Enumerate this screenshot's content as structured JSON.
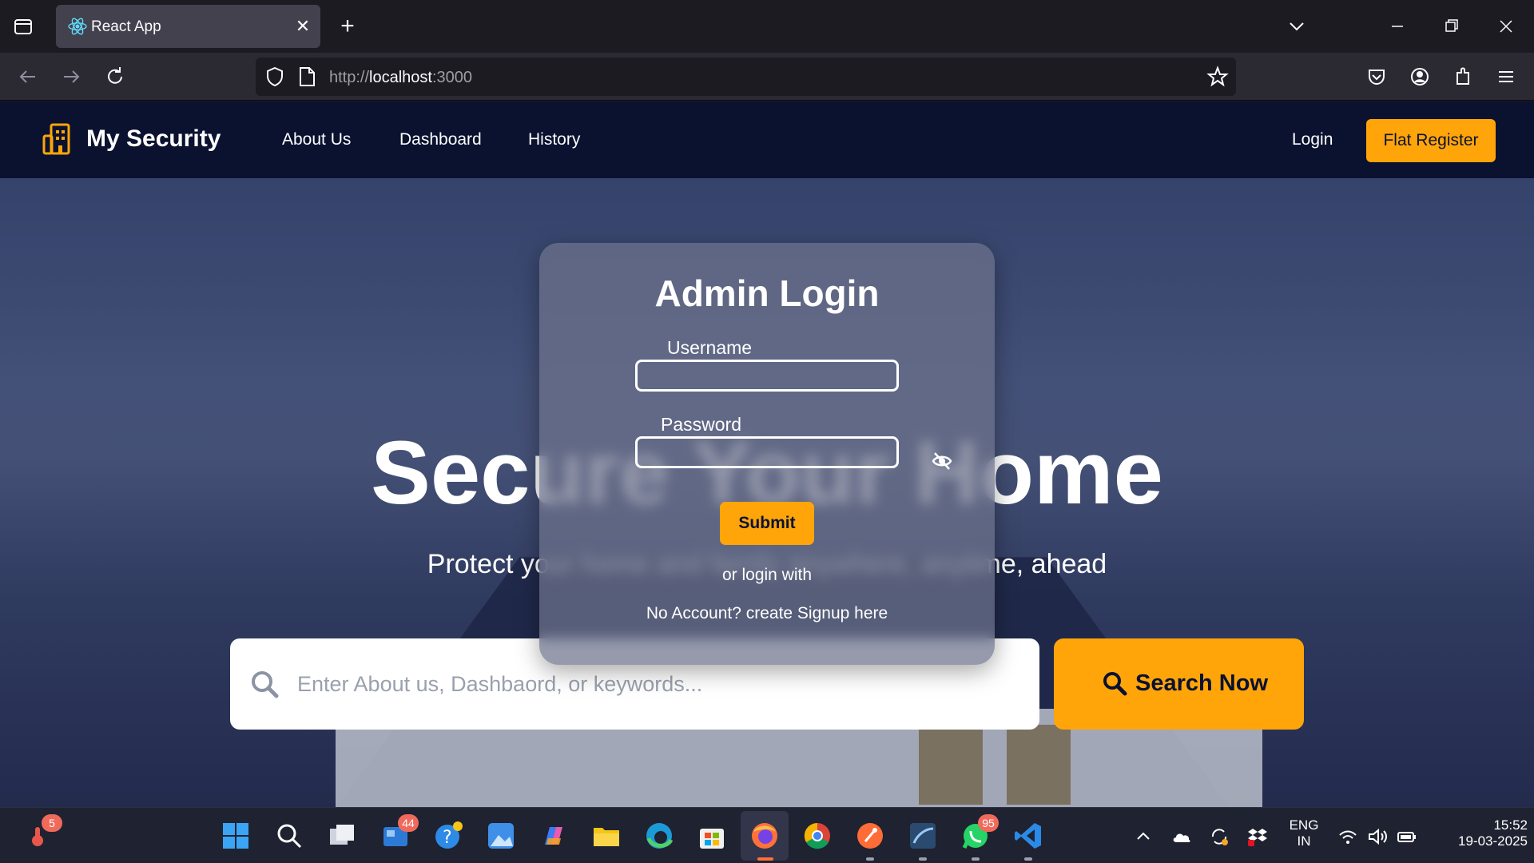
{
  "browser": {
    "tab_title": "React App",
    "url_scheme": "http://",
    "url_host": "localhost",
    "url_port": ":3000"
  },
  "site": {
    "brand": "My Security",
    "menu": [
      "About Us",
      "Dashboard",
      "History"
    ],
    "login_label": "Login",
    "register_label": "Flat Register",
    "hero_title": "Secure Your Home",
    "hero_subtitle": "Protect your home and family anywhere, anytime, ahead",
    "search_placeholder": "Enter About us, Dashbaord, or keywords...",
    "search_button": "Search Now",
    "accent_color": "#ffa50a",
    "header_color": "#0a1230"
  },
  "modal": {
    "title": "Admin Login",
    "username_label": "Username",
    "password_label": "Password",
    "submit_label": "Submit",
    "alt_login_text": "or login with",
    "signup_text": "No Account? create Signup here"
  },
  "taskbar": {
    "weather_badge": "5",
    "mail_badge": "44",
    "whatsapp_badge": "95",
    "lang_line1": "ENG",
    "lang_line2": "IN",
    "time": "15:52",
    "date": "19-03-2025"
  }
}
